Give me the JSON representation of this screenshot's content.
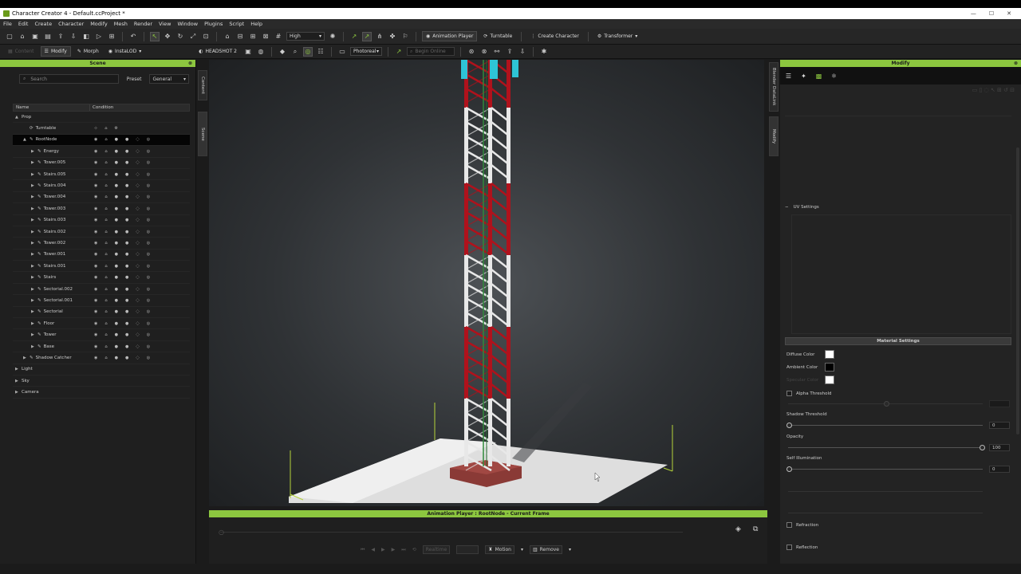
{
  "window": {
    "title": "Character Creator 4 - Default.ccProject *",
    "controls": [
      "—",
      "☐",
      "✕"
    ]
  },
  "menu": [
    "File",
    "Edit",
    "Create",
    "Character",
    "Modify",
    "Mesh",
    "Render",
    "View",
    "Window",
    "Plugins",
    "Script",
    "Help"
  ],
  "toolbar": {
    "quality": "High",
    "animation_player": "Animation Player",
    "turntable": "Turntable",
    "create_character": "Create Character",
    "transformer": "Transformer"
  },
  "toolbar2": {
    "content": "Content",
    "modify": "Modify",
    "morph": "Morph",
    "instalod": "InstaLOD",
    "headshot": "HEADSHOT 2",
    "render_mode": "Photoreal",
    "search_placeholder": "Begin Online"
  },
  "scene": {
    "title": "Scene",
    "search_placeholder": "Search",
    "preset_label": "Preset",
    "preset_value": "General",
    "col_name": "Name",
    "col_condition": "Condition",
    "rows": [
      {
        "label": "Prop",
        "depth": 0,
        "arrow": "▲",
        "icons": false,
        "selected": false
      },
      {
        "label": "Turntable",
        "depth": 1,
        "arrow": "",
        "icons": "short",
        "selected": false
      },
      {
        "label": "RootNode",
        "depth": 1,
        "arrow": "▲",
        "icons": true,
        "selected": true
      },
      {
        "label": "Energy",
        "depth": 2,
        "arrow": "▶",
        "icons": true,
        "selected": false
      },
      {
        "label": "Tower.005",
        "depth": 2,
        "arrow": "▶",
        "icons": true,
        "selected": false
      },
      {
        "label": "Stairs.005",
        "depth": 2,
        "arrow": "▶",
        "icons": true,
        "selected": false
      },
      {
        "label": "Stairs.004",
        "depth": 2,
        "arrow": "▶",
        "icons": true,
        "selected": false
      },
      {
        "label": "Tower.004",
        "depth": 2,
        "arrow": "▶",
        "icons": true,
        "selected": false
      },
      {
        "label": "Tower.003",
        "depth": 2,
        "arrow": "▶",
        "icons": true,
        "selected": false
      },
      {
        "label": "Stairs.003",
        "depth": 2,
        "arrow": "▶",
        "icons": true,
        "selected": false
      },
      {
        "label": "Stairs.002",
        "depth": 2,
        "arrow": "▶",
        "icons": true,
        "selected": false
      },
      {
        "label": "Tower.002",
        "depth": 2,
        "arrow": "▶",
        "icons": true,
        "selected": false
      },
      {
        "label": "Tower.001",
        "depth": 2,
        "arrow": "▶",
        "icons": true,
        "selected": false
      },
      {
        "label": "Stairs.001",
        "depth": 2,
        "arrow": "▶",
        "icons": true,
        "selected": false
      },
      {
        "label": "Stairs",
        "depth": 2,
        "arrow": "▶",
        "icons": true,
        "selected": false
      },
      {
        "label": "Sectorial.002",
        "depth": 2,
        "arrow": "▶",
        "icons": true,
        "selected": false
      },
      {
        "label": "Sectorial.001",
        "depth": 2,
        "arrow": "▶",
        "icons": true,
        "selected": false
      },
      {
        "label": "Sectorial",
        "depth": 2,
        "arrow": "▶",
        "icons": true,
        "selected": false
      },
      {
        "label": "Floor",
        "depth": 2,
        "arrow": "▶",
        "icons": true,
        "selected": false
      },
      {
        "label": "Tower",
        "depth": 2,
        "arrow": "▶",
        "icons": true,
        "selected": false
      },
      {
        "label": "Base",
        "depth": 2,
        "arrow": "▶",
        "icons": true,
        "selected": false
      },
      {
        "label": "Shadow Catcher",
        "depth": 1,
        "arrow": "▶",
        "icons": true,
        "selected": false
      },
      {
        "label": "Light",
        "depth": 0,
        "arrow": "▶",
        "icons": false,
        "selected": false
      },
      {
        "label": "Sky",
        "depth": 0,
        "arrow": "▶",
        "icons": false,
        "selected": false
      },
      {
        "label": "Camera",
        "depth": 0,
        "arrow": "▶",
        "icons": false,
        "selected": false
      }
    ]
  },
  "side_tabs": {
    "content": "Content",
    "scene": "Scene",
    "blender_datalink": "Blender DataLink",
    "modify": "Modify"
  },
  "animation_player": {
    "title": "Animation Player : RootNode - Current Frame",
    "realtime": "Realtime",
    "motion": "Motion",
    "remove": "Remove"
  },
  "modify": {
    "title": "Modify",
    "uv_settings": "UV Settings",
    "material_settings": "Material Settings",
    "diffuse_color_label": "Diffuse Color",
    "diffuse_color": "#ffffff",
    "ambient_color_label": "Ambient Color",
    "ambient_color": "#000000",
    "specular_color_label": "Specular Color",
    "specular_color": "#ffffff",
    "alpha_threshold": "Alpha Threshold",
    "shadow_threshold": "Shadow Threshold",
    "shadow_threshold_value": "0",
    "opacity": "Opacity",
    "opacity_value": "100",
    "self_illumination": "Self Illumination",
    "self_illumination_value": "0",
    "refraction": "Refraction",
    "reflection": "Reflection"
  },
  "colors": {
    "accent": "#8cc63f",
    "tower_red": "#b0121c",
    "tower_white": "#e8e8e8",
    "base": "#8a3a36"
  }
}
